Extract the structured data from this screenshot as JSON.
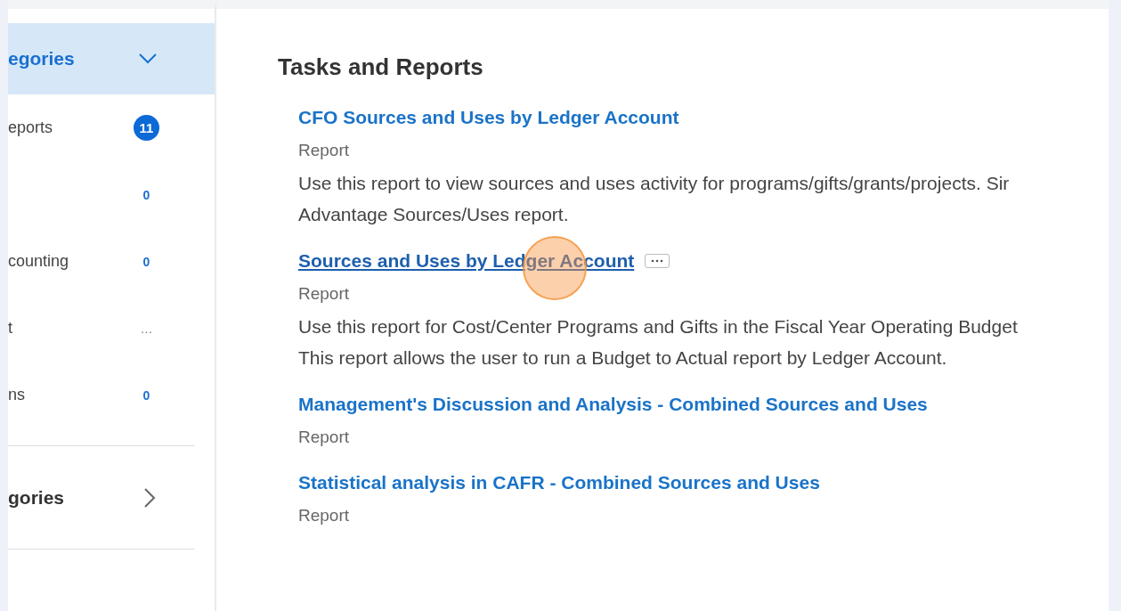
{
  "sidebar": {
    "header": {
      "label": "egories",
      "expanded": true
    },
    "items": [
      {
        "label": "eports",
        "count": "11",
        "kind": "badge"
      },
      {
        "count": "0",
        "kind": "plain"
      },
      {
        "label": "counting",
        "count": "0",
        "kind": "plain"
      },
      {
        "label": "t",
        "count": "…",
        "kind": "muted"
      },
      {
        "label": "ns",
        "count": "0",
        "kind": "plain"
      }
    ],
    "section": {
      "label": "gories",
      "expanded": false
    }
  },
  "main": {
    "title": "Tasks and Reports",
    "results": [
      {
        "title": "CFO Sources and Uses by Ledger Account",
        "type": "Report",
        "hovered": false,
        "description": [
          "Use this report to view sources and uses activity for programs/gifts/grants/projects. Sir",
          "Advantage Sources/Uses report."
        ]
      },
      {
        "title": "Sources and Uses by Ledger Account",
        "type": "Report",
        "hovered": true,
        "description": [
          "Use this report for Cost/Center Programs and Gifts in the Fiscal Year Operating Budget",
          "This report allows the user to run a Budget to Actual report by Ledger Account."
        ]
      },
      {
        "title": "Management's Discussion and Analysis - Combined Sources and Uses",
        "type": "Report",
        "hovered": false
      },
      {
        "title": "Statistical analysis in CAFR - Combined Sources and Uses",
        "type": "Report",
        "hovered": false
      }
    ]
  }
}
